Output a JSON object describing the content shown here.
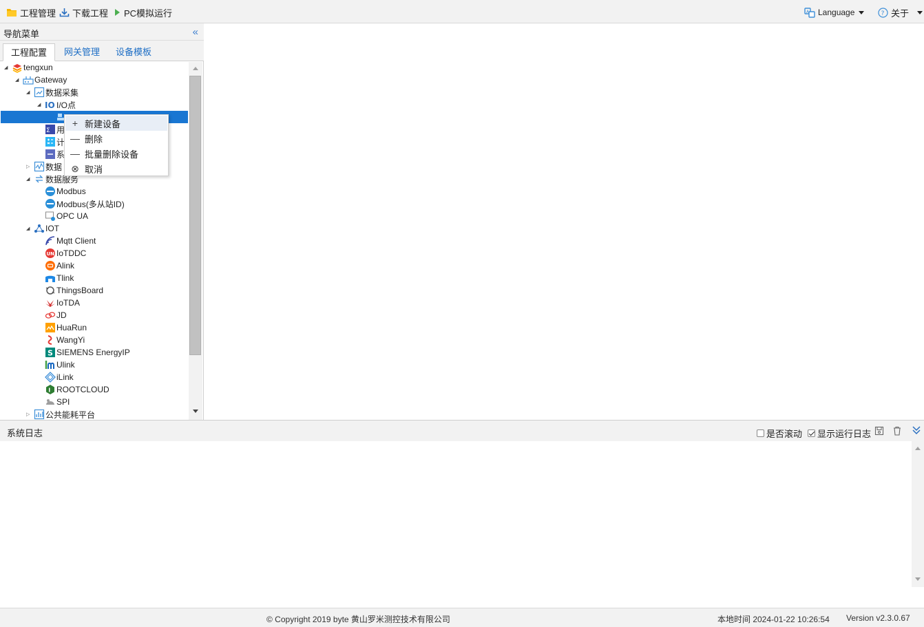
{
  "toolbar": {
    "project_manage": "工程管理",
    "download_project": "下载工程",
    "pc_simulate": "PC模拟运行",
    "language": "Language",
    "about": "关于"
  },
  "nav": {
    "title": "导航菜单",
    "tabs": [
      "工程配置",
      "网关管理",
      "设备模板"
    ]
  },
  "tree": {
    "root": "tengxun",
    "gateway": "Gateway",
    "data_collect": "数据采集",
    "io_point": "I/O点",
    "user_partial": "用",
    "calc_partial": "计",
    "sys_partial": "系",
    "data_partial": "数据",
    "data_service": "数据服务",
    "modbus": "Modbus",
    "modbus_multi": "Modbus(多从站ID)",
    "opcua": "OPC UA",
    "iot": "IOT",
    "iot_items": [
      "Mqtt Client",
      "IoTDDC",
      "Alink",
      "Tlink",
      "ThingsBoard",
      "IoTDA",
      "JD",
      "HuaRun",
      "WangYi",
      "SIEMENS EnergyIP",
      "Ulink",
      "iLink",
      "ROOTCLOUD",
      "SPI"
    ],
    "public_energy": "公共能耗平台"
  },
  "context_menu": {
    "new_device": "新建设备",
    "delete": "删除",
    "batch_delete": "批量删除设备",
    "cancel": "取消"
  },
  "log": {
    "title": "系统日志",
    "auto_scroll_label": "是否滚动",
    "auto_scroll_checked": false,
    "show_run_log_label": "显示运行日志",
    "show_run_log_checked": true
  },
  "footer": {
    "copyright": "© Copyright 2019 byte 黄山罗米测控技术有限公司",
    "local_time": "本地时间 2024-01-22 10:26:54",
    "version": "Version v2.3.0.67"
  },
  "colors": {
    "accent": "#1976d2",
    "link": "#1f6fc5"
  }
}
